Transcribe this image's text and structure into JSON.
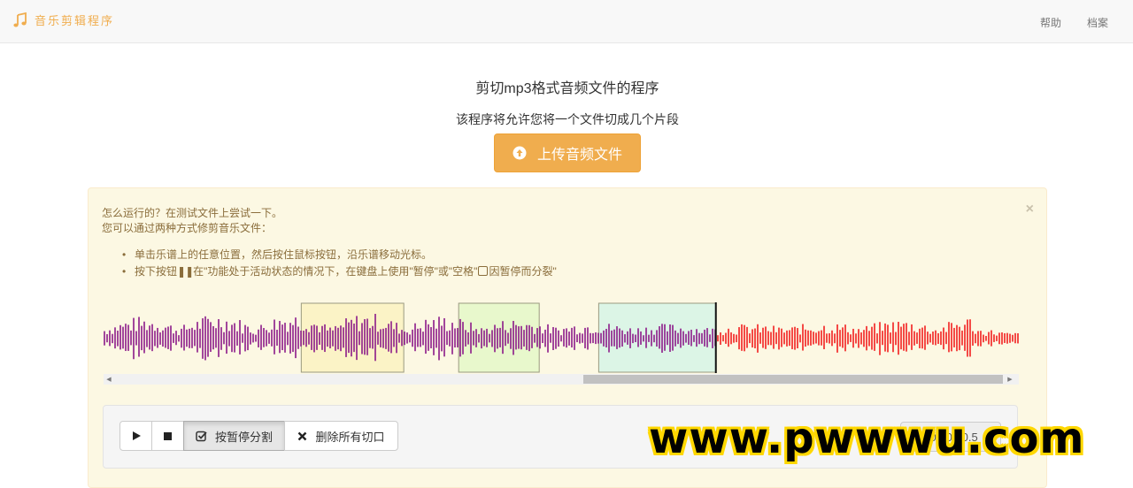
{
  "nav": {
    "brand": "音乐剪辑程序",
    "links": [
      "帮助",
      "档案"
    ]
  },
  "header": {
    "title": "剪切mp3格式音频文件的程序",
    "subtitle": "该程序将允许您将一个文件切成几个片段",
    "upload_label": "上传音频文件"
  },
  "alert": {
    "close": "×",
    "line1": "怎么运行的？在测试文件上尝试一下。",
    "line2": "您可以通过两种方式修剪音乐文件：",
    "bullet1": "单击乐谱上的任意位置，然后按住鼠标按钮，沿乐谱移动光标。",
    "bullet2_a": "按下按钮",
    "bullet2_b": "在\"功能处于活动状态的情况下，在键盘上使用\"暂停\"或\"空格\"",
    "bullet2_c": "因暂停而分裂\""
  },
  "waveform": {
    "played_color": "#8b1a89",
    "unplayed_color": "#f21f1f",
    "cursor_fraction": 0.669,
    "regions": [
      {
        "start": 0.216,
        "end": 0.328,
        "color": "#fbf3c6"
      },
      {
        "start": 0.388,
        "end": 0.476,
        "color": "#e8f8cc"
      },
      {
        "start": 0.541,
        "end": 0.669,
        "color": "#dcf5e6"
      }
    ]
  },
  "controls": {
    "pause_split_label": "按暂停分割",
    "delete_cuts_label": "删除所有切口",
    "time_display": "00:00:00.5"
  },
  "watermark": "www.pwwwu.com",
  "colors": {
    "accent": "#f0ad4e",
    "alert_bg": "#fcf8e3",
    "alert_text": "#8a6d3b"
  }
}
